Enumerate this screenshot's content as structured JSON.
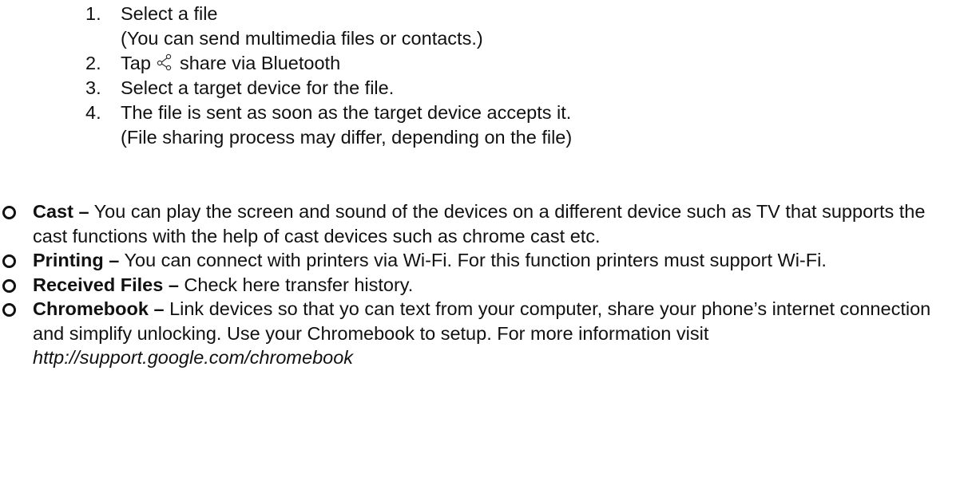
{
  "steps": [
    {
      "number": "1.",
      "text": "Select a file",
      "note": "(You can send multimedia files or contacts.)"
    },
    {
      "number": "2.",
      "text_before": "Tap",
      "icon": "share-icon",
      "text_after": "share via Bluetooth"
    },
    {
      "number": "3.",
      "text": "Select a target device for the file."
    },
    {
      "number": "4.",
      "text": "The file is sent as soon as the target device accepts it.",
      "note": "(File sharing process may differ, depending on the file)"
    }
  ],
  "features": [
    {
      "term": "Cast –",
      "description": "You can play the screen and sound of the devices on a different device such as TV that supports the cast functions with the help of cast devices such as chrome cast etc."
    },
    {
      "term": "Printing –",
      "description": "You can connect with printers via Wi-Fi. For this function printers must support Wi-Fi."
    },
    {
      "term": "Received Files –",
      "description": "Check here transfer history."
    },
    {
      "term": "Chromebook –",
      "description": "Link devices so that yo can text from your computer, share your phone’s internet connection and simplify unlocking. Use your Chromebook to setup. For more information visit",
      "link": "http://support.google.com/chromebook"
    }
  ],
  "bullet_icon": "ring-bullet-icon",
  "text_color": "#111111"
}
